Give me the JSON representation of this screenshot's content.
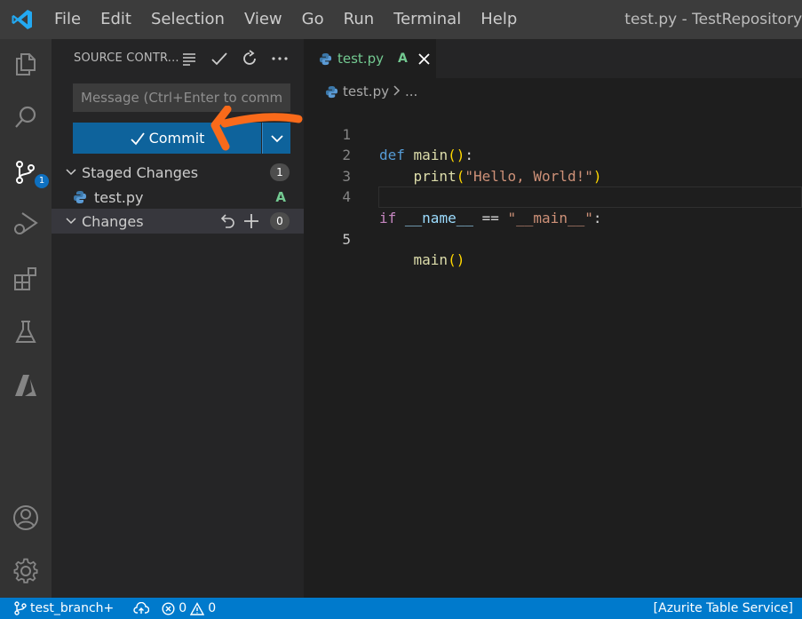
{
  "menu": [
    "File",
    "Edit",
    "Selection",
    "View",
    "Go",
    "Run",
    "Terminal",
    "Help"
  ],
  "window_title": "test.py - TestRepository",
  "activity": {
    "scm_badge": "1"
  },
  "sidebar": {
    "title": "SOURCE CONTR...",
    "message_placeholder": "Message (Ctrl+Enter to comm...",
    "commit_label": "Commit",
    "staged": {
      "label": "Staged Changes",
      "count": "1"
    },
    "staged_files": [
      {
        "name": "test.py",
        "status": "A"
      }
    ],
    "changes": {
      "label": "Changes",
      "count": "0"
    }
  },
  "editor": {
    "tab": {
      "label": "test.py",
      "status": "A"
    },
    "breadcrumb": {
      "file": "test.py",
      "rest": "..."
    },
    "line_numbers": [
      "1",
      "2",
      "3",
      "4",
      "5"
    ],
    "code": {
      "l1": {
        "def": "def",
        "name": "main",
        "parens": "()",
        "colon": ":"
      },
      "l2": {
        "indent": "    ",
        "fn": "print",
        "open": "(",
        "str": "\"Hello, World!\"",
        "close": ")"
      },
      "l4": {
        "if": "if",
        "var": "__name__",
        "op": "==",
        "str": "\"__main__\"",
        "colon": ":"
      },
      "l5": {
        "indent": "    ",
        "fn": "main",
        "parens": "()"
      }
    }
  },
  "statusbar": {
    "branch": "test_branch+",
    "errors": "0",
    "warnings": "0",
    "right": "[Azurite Table Service]"
  },
  "colors": {
    "accent": "#007acc",
    "added": "#73c991",
    "button": "#0e639c",
    "annotation_arrow": "#f96a1a"
  }
}
